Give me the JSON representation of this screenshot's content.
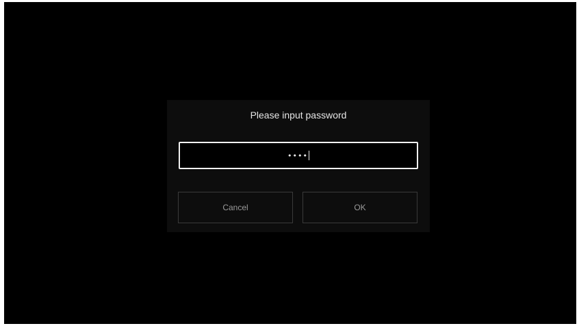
{
  "dialog": {
    "title": "Please input password",
    "password": {
      "masked_value": "••••"
    },
    "buttons": {
      "cancel_label": "Cancel",
      "ok_label": "OK"
    }
  },
  "colors": {
    "screen_background": "#000000",
    "dialog_background": "#0d0d0d",
    "field_border": "#f2f2f2",
    "button_border": "#3a3a3a",
    "button_text": "#9a9a9a"
  }
}
